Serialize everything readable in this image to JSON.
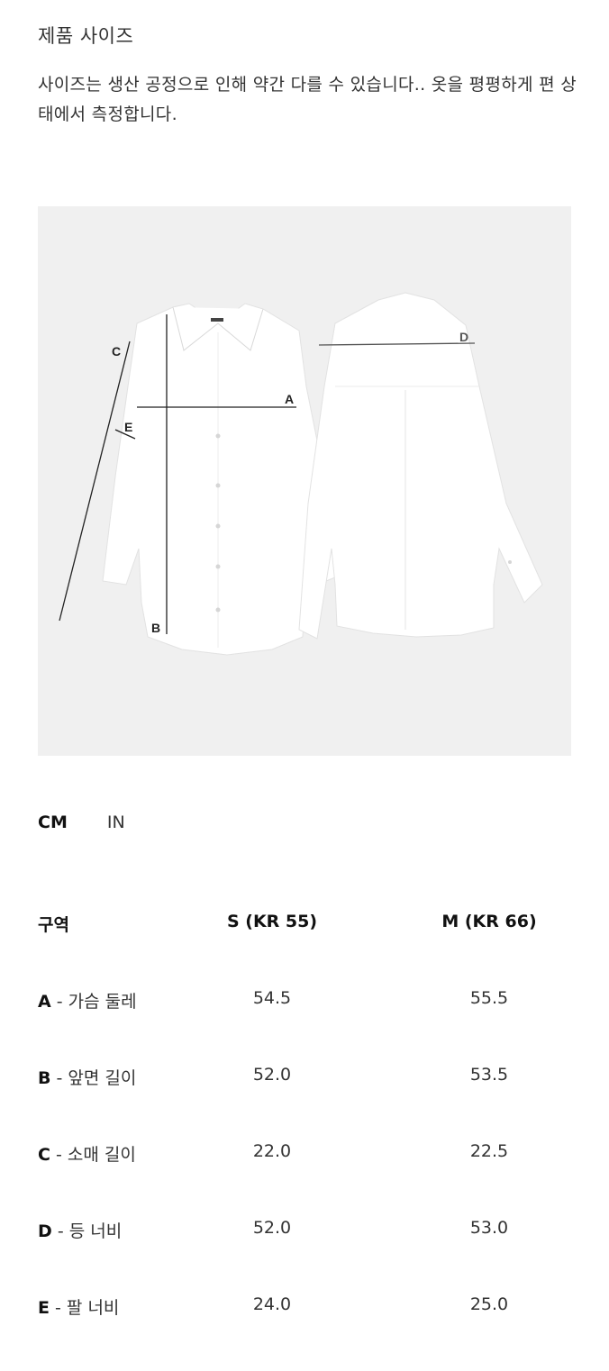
{
  "header": {
    "title": "제품 사이즈",
    "description": "사이즈는 생산 공정으로 인해 약간 다를 수 있습니다.. 옷을 평평하게 편 상태에서 측정합니다."
  },
  "figure": {
    "labels": {
      "a": "A",
      "b": "B",
      "c": "C",
      "d": "D",
      "e": "E"
    }
  },
  "units": {
    "cm": "CM",
    "in": "IN",
    "active": "cm"
  },
  "table": {
    "headers": {
      "area": "구역",
      "s": "S (KR 55)",
      "m": "M (KR 66)"
    },
    "rows": [
      {
        "code": "A",
        "sep": " - ",
        "name": "가슴 둘레",
        "s": "54.5",
        "m": "55.5"
      },
      {
        "code": "B",
        "sep": " - ",
        "name": "앞면 길이",
        "s": "52.0",
        "m": "53.5"
      },
      {
        "code": "C",
        "sep": " - ",
        "name": "소매 길이",
        "s": "22.0",
        "m": "22.5"
      },
      {
        "code": "D",
        "sep": " - ",
        "name": "등 너비",
        "s": "52.0",
        "m": "53.0"
      },
      {
        "code": "E",
        "sep": " - ",
        "name": "팔 너비",
        "s": "24.0",
        "m": "25.0"
      }
    ]
  },
  "colors": {
    "figure_bg": "#f0f0f0",
    "shirt": "#ffffff",
    "measure_line": "#222222"
  }
}
